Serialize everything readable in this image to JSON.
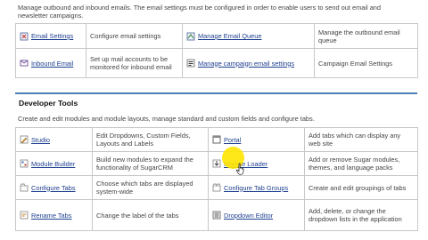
{
  "email_section": {
    "description": "Manage outbound and inbound emails. The email settings must be configured in order to enable users to send out email and newsletter campaigns.",
    "rows": [
      [
        {
          "icon": "email-settings-icon",
          "link": "Email Settings",
          "desc": "Configure email settings"
        },
        {
          "icon": "email-queue-icon",
          "link": "Manage Email Queue",
          "desc": "Manage the outbound email queue"
        }
      ],
      [
        {
          "icon": "inbound-email-icon",
          "link": "Inbound Email",
          "desc": "Set up mail accounts to be monitored for inbound email"
        },
        {
          "icon": "campaign-email-icon",
          "link": "Manage campaign email settings",
          "desc": "Campaign Email Settings"
        }
      ]
    ]
  },
  "developer_tools": {
    "title": "Developer Tools",
    "description": "Create and edit modules and module layouts, manage standard and custom fields and configure tabs.",
    "rows": [
      [
        {
          "icon": "studio-icon",
          "link": "Studio",
          "desc": "Edit Dropdowns, Custom Fields, Layouts and Labels"
        },
        {
          "icon": "portal-icon",
          "link": "Portal",
          "desc": "Add tabs which can display any web site"
        }
      ],
      [
        {
          "icon": "module-builder-icon",
          "link": "Module Builder",
          "desc": "Build new modules to expand the functionality of SugarCRM"
        },
        {
          "icon": "module-loader-icon",
          "link": "Module Loader",
          "desc": "Add or remove Sugar modules, themes, and language packs"
        }
      ],
      [
        {
          "icon": "configure-tabs-icon",
          "link": "Configure Tabs",
          "desc": "Choose which tabs are displayed system-wide"
        },
        {
          "icon": "configure-tab-groups-icon",
          "link": "Configure Tab Groups",
          "desc": "Create and edit groupings of tabs"
        }
      ],
      [
        {
          "icon": "rename-tabs-icon",
          "link": "Rename Tabs",
          "desc": "Change the label of the tabs"
        },
        {
          "icon": "dropdown-editor-icon",
          "link": "Dropdown Editor",
          "desc": "Add, delete, or change the dropdown lists in the application"
        }
      ]
    ]
  }
}
